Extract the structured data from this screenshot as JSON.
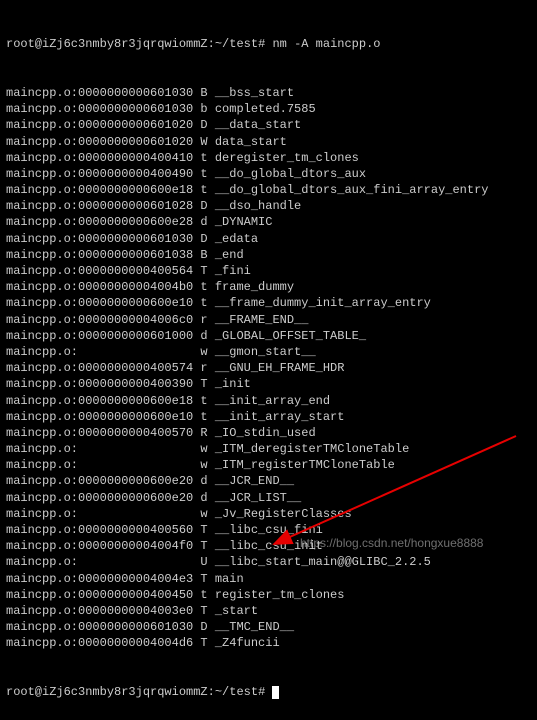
{
  "prompt": {
    "user_host": "root@iZj6c3nmby8r3jqrqwiommZ",
    "path": "~/test",
    "separator": "#",
    "command": "nm -A maincpp.o"
  },
  "rows": [
    {
      "file": "maincpp.o",
      "addr": "0000000000601030",
      "type": "B",
      "sym": "__bss_start"
    },
    {
      "file": "maincpp.o",
      "addr": "0000000000601030",
      "type": "b",
      "sym": "completed.7585"
    },
    {
      "file": "maincpp.o",
      "addr": "0000000000601020",
      "type": "D",
      "sym": "__data_start"
    },
    {
      "file": "maincpp.o",
      "addr": "0000000000601020",
      "type": "W",
      "sym": "data_start"
    },
    {
      "file": "maincpp.o",
      "addr": "0000000000400410",
      "type": "t",
      "sym": "deregister_tm_clones"
    },
    {
      "file": "maincpp.o",
      "addr": "0000000000400490",
      "type": "t",
      "sym": "__do_global_dtors_aux"
    },
    {
      "file": "maincpp.o",
      "addr": "0000000000600e18",
      "type": "t",
      "sym": "__do_global_dtors_aux_fini_array_entry"
    },
    {
      "file": "maincpp.o",
      "addr": "0000000000601028",
      "type": "D",
      "sym": "__dso_handle"
    },
    {
      "file": "maincpp.o",
      "addr": "0000000000600e28",
      "type": "d",
      "sym": "_DYNAMIC"
    },
    {
      "file": "maincpp.o",
      "addr": "0000000000601030",
      "type": "D",
      "sym": "_edata"
    },
    {
      "file": "maincpp.o",
      "addr": "0000000000601038",
      "type": "B",
      "sym": "_end"
    },
    {
      "file": "maincpp.o",
      "addr": "0000000000400564",
      "type": "T",
      "sym": "_fini"
    },
    {
      "file": "maincpp.o",
      "addr": "00000000004004b0",
      "type": "t",
      "sym": "frame_dummy"
    },
    {
      "file": "maincpp.o",
      "addr": "0000000000600e10",
      "type": "t",
      "sym": "__frame_dummy_init_array_entry"
    },
    {
      "file": "maincpp.o",
      "addr": "00000000004006c0",
      "type": "r",
      "sym": "__FRAME_END__"
    },
    {
      "file": "maincpp.o",
      "addr": "0000000000601000",
      "type": "d",
      "sym": "_GLOBAL_OFFSET_TABLE_"
    },
    {
      "file": "maincpp.o",
      "addr": "",
      "type": "w",
      "sym": "__gmon_start__"
    },
    {
      "file": "maincpp.o",
      "addr": "0000000000400574",
      "type": "r",
      "sym": "__GNU_EH_FRAME_HDR"
    },
    {
      "file": "maincpp.o",
      "addr": "0000000000400390",
      "type": "T",
      "sym": "_init"
    },
    {
      "file": "maincpp.o",
      "addr": "0000000000600e18",
      "type": "t",
      "sym": "__init_array_end"
    },
    {
      "file": "maincpp.o",
      "addr": "0000000000600e10",
      "type": "t",
      "sym": "__init_array_start"
    },
    {
      "file": "maincpp.o",
      "addr": "0000000000400570",
      "type": "R",
      "sym": "_IO_stdin_used"
    },
    {
      "file": "maincpp.o",
      "addr": "",
      "type": "w",
      "sym": "_ITM_deregisterTMCloneTable"
    },
    {
      "file": "maincpp.o",
      "addr": "",
      "type": "w",
      "sym": "_ITM_registerTMCloneTable"
    },
    {
      "file": "maincpp.o",
      "addr": "0000000000600e20",
      "type": "d",
      "sym": "__JCR_END__"
    },
    {
      "file": "maincpp.o",
      "addr": "0000000000600e20",
      "type": "d",
      "sym": "__JCR_LIST__"
    },
    {
      "file": "maincpp.o",
      "addr": "",
      "type": "w",
      "sym": "_Jv_RegisterClasses"
    },
    {
      "file": "maincpp.o",
      "addr": "0000000000400560",
      "type": "T",
      "sym": "__libc_csu_fini"
    },
    {
      "file": "maincpp.o",
      "addr": "00000000004004f0",
      "type": "T",
      "sym": "__libc_csu_init"
    },
    {
      "file": "maincpp.o",
      "addr": "",
      "type": "U",
      "sym": "__libc_start_main@@GLIBC_2.2.5"
    },
    {
      "file": "maincpp.o",
      "addr": "00000000004004e3",
      "type": "T",
      "sym": "main"
    },
    {
      "file": "maincpp.o",
      "addr": "0000000000400450",
      "type": "t",
      "sym": "register_tm_clones"
    },
    {
      "file": "maincpp.o",
      "addr": "00000000004003e0",
      "type": "T",
      "sym": "_start"
    },
    {
      "file": "maincpp.o",
      "addr": "0000000000601030",
      "type": "D",
      "sym": "__TMC_END__"
    },
    {
      "file": "maincpp.o",
      "addr": "00000000004004d6",
      "type": "T",
      "sym": "_Z4funcii"
    }
  ],
  "watermark": "https://blog.csdn.net/hongxue8888",
  "annotation": {
    "arrow_color": "#e60000"
  }
}
